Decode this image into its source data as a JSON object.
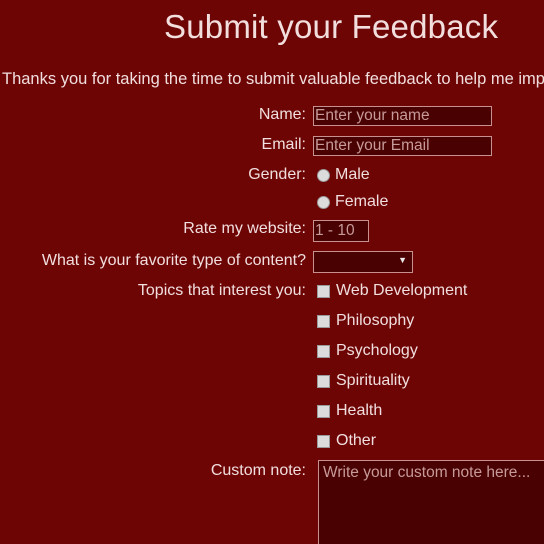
{
  "header": {
    "title": "Submit your Feedback",
    "intro": "Thanks you for taking the time to submit valuable feedback to help me improve"
  },
  "form": {
    "name_label": "Name:",
    "name_placeholder": "Enter your name",
    "email_label": "Email:",
    "email_placeholder": "Enter your Email",
    "gender_label": "Gender:",
    "gender_options": [
      "Male",
      "Female"
    ],
    "rating_label": "Rate my website:",
    "rating_placeholder": "1 - 10",
    "content_label": "What is your favorite type of content?",
    "content_selected": "",
    "topics_label": "Topics that interest you:",
    "topics": [
      "Web Development",
      "Philosophy",
      "Psychology",
      "Spirituality",
      "Health",
      "Other"
    ],
    "note_label": "Custom note:",
    "note_placeholder": "Write your custom note here..."
  },
  "colors": {
    "background": "#6e0505",
    "field_background": "#4a0101",
    "text": "#f1dede"
  },
  "icons": {
    "select_arrow": "triangle-down"
  }
}
